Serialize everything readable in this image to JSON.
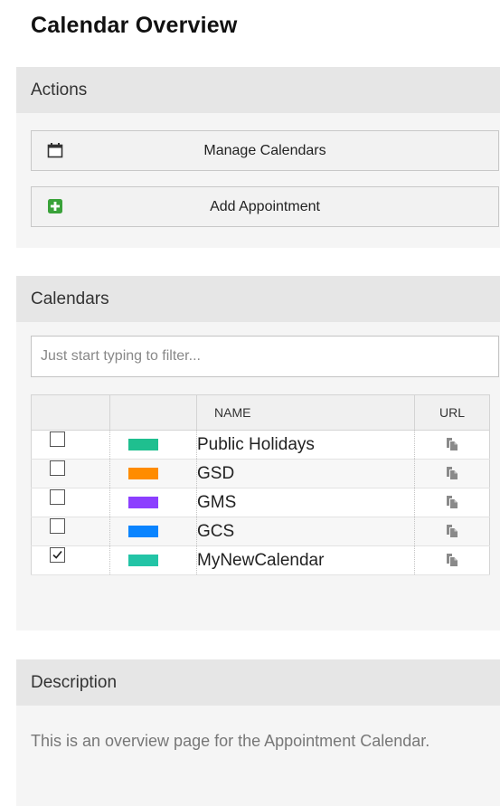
{
  "page": {
    "title": "Calendar Overview"
  },
  "actions": {
    "header": "Actions",
    "manage_label": "Manage Calendars",
    "add_label": "Add Appointment"
  },
  "calendars": {
    "header": "Calendars",
    "filter_placeholder": "Just start typing to filter...",
    "columns": {
      "check": "",
      "color": "",
      "name": "NAME",
      "url": "URL"
    },
    "rows": [
      {
        "name": "Public Holidays",
        "color": "#1fbf8f",
        "checked": false
      },
      {
        "name": "GSD",
        "color": "#ff8c00",
        "checked": false
      },
      {
        "name": "GMS",
        "color": "#8c3fff",
        "checked": false
      },
      {
        "name": "GCS",
        "color": "#0a84ff",
        "checked": false
      },
      {
        "name": "MyNewCalendar",
        "color": "#23c4a6",
        "checked": true
      }
    ]
  },
  "description": {
    "header": "Description",
    "text": "This is an overview page for the Appointment Calendar."
  },
  "icons": {
    "manage": "calendar-icon",
    "add": "plus-square-icon",
    "copy": "copy-icon"
  },
  "colors": {
    "add_icon": "#3aa23a",
    "panel_header": "#e6e6e6",
    "panel_body": "#f5f5f5"
  }
}
